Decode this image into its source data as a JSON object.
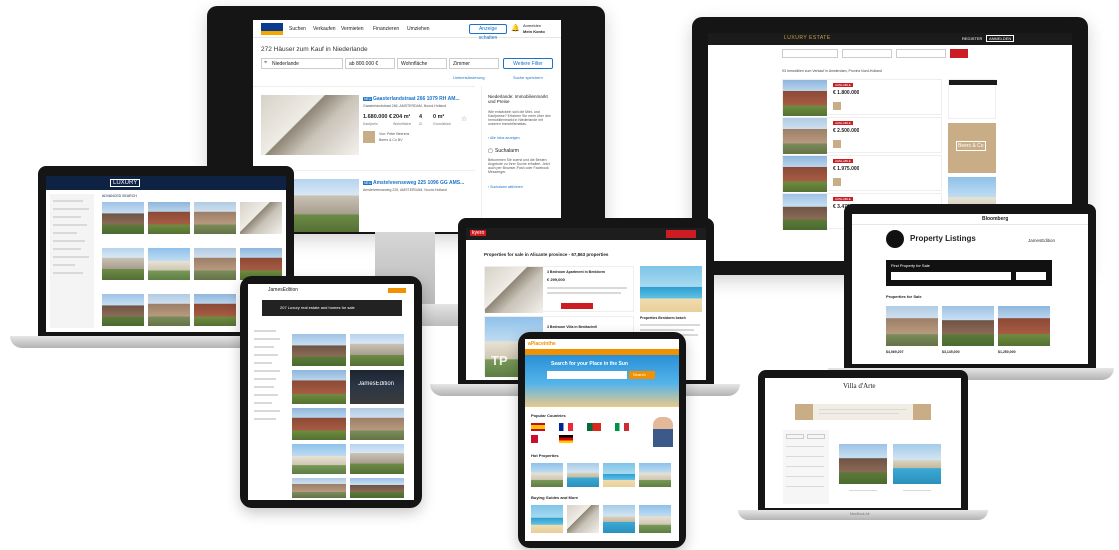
{
  "main_monitor": {
    "brand": "",
    "nav": [
      "Suchen",
      "Verkaufen",
      "Vermieten",
      "Finanzieren",
      "Umziehen"
    ],
    "header_button": "Anzeige schalten",
    "account": "Anmelden",
    "account_sub": "Mein Konto",
    "results_title": "272 Häuser zum Kauf in Niederlande",
    "filters": {
      "location": "Niederlande",
      "price": "ab 800.000 €",
      "area": "Wohnfläche",
      "rooms": "Zimmer",
      "more": "Weitere Filter"
    },
    "links": {
      "distance": "Umkreisänderung",
      "save": "Suche speichern"
    },
    "listings": [
      {
        "tag": "NEU",
        "title": "Gaasterlandstraat 266 1079 RH AM...",
        "subtitle": "Gaasterlandstraat 266, AMSTERDAM, Noord-Holland",
        "price": "1.680.000 €",
        "price_label": "Kaufpreis",
        "area": "204 m²",
        "area_label": "Wohnfläche",
        "rooms": "4",
        "rooms_label": "Zi.",
        "plot": "0 m²",
        "plot_label": "Grundstück",
        "agent": "Von: Peter Beerens",
        "agency": "Beers & Co BV"
      },
      {
        "tag": "NEU",
        "title": "Amstelveenseweg 225 1096 GG AMS...",
        "subtitle": "Amstelveenseweg 225, AMSTERDAM, Noord-Holland"
      }
    ],
    "sidebar": {
      "heading": "Niederlande: Immobilienmarkt und Preise",
      "body": "Wie entwickeln sich die Miet- und Kaufpreise? Erfahren Sie mehr über den Immobilienmarkt in Niederlande mit unseren Immobilienatlas.",
      "link": "› Alle Infos anzeigen",
      "alarm_title": "Suchalarm",
      "alarm_body": "Bekommen Sie zuerst und die Besten Angebote zu Ihrer Suche erhalten. Jetzt auch per Browser-Push oder Facebook Messenger.",
      "alarm_link": "› Suchalarm aktivieren"
    }
  },
  "right_monitor": {
    "brand": "LUXURY ESTATE",
    "sub_brand": "",
    "buttons": [
      "REGISTER",
      "ANMELDEN"
    ],
    "heading": "93 Immobilien zum Verkauf in Amsterdam, Provinz Nord-Holland",
    "listings": [
      {
        "price": "€ 1.800.000",
        "status": "AVAILABLE"
      },
      {
        "price": "€ 2.500.000",
        "status": "AVAILABLE"
      },
      {
        "price": "€ 1.975.000",
        "status": "AVAILABLE"
      },
      {
        "price": "€ 3.470.000",
        "status": "AVAILABLE"
      }
    ],
    "ad_label": "Beers & Co"
  },
  "left_laptop": {
    "brand": "LUXURY",
    "search_label": "ADVANCED SEARCH"
  },
  "center_laptop": {
    "brand": "kyero",
    "heading": "Properties for sale in Alicante province - 67,863 properties",
    "listing_title": "3 Bedroom Apartment in Benidorm",
    "listing_price": "€ 299,000",
    "listing_title_2": "3 Bedroom Villa in Benitachell",
    "side_heading": "Properties Benidorm beach",
    "watermark": "TP"
  },
  "right_laptop": {
    "brand": "Bloomberg",
    "title": "Property Listings",
    "partner": "JamesEdition",
    "search_label": "Find Property for Sale",
    "section": "Properties for Sale",
    "listings": [
      {
        "price": "$4,069,207"
      },
      {
        "price": "$3,145,000"
      },
      {
        "price": "$1,250,000"
      }
    ]
  },
  "left_tablet": {
    "brand": "JamesEdition",
    "banner": "207 Luxury real estate and homes for sale"
  },
  "center_tablet": {
    "brand": "aPlaceinthe",
    "hero": "Search for your Place in the Sun",
    "search_button": "Search",
    "section_countries": "Popular Countries",
    "section_properties": "Hot Properties",
    "section_guides": "Buying Guides and More"
  },
  "bottom_laptop": {
    "brand": "Villa d'Arte",
    "footer": "MacBook Air"
  }
}
